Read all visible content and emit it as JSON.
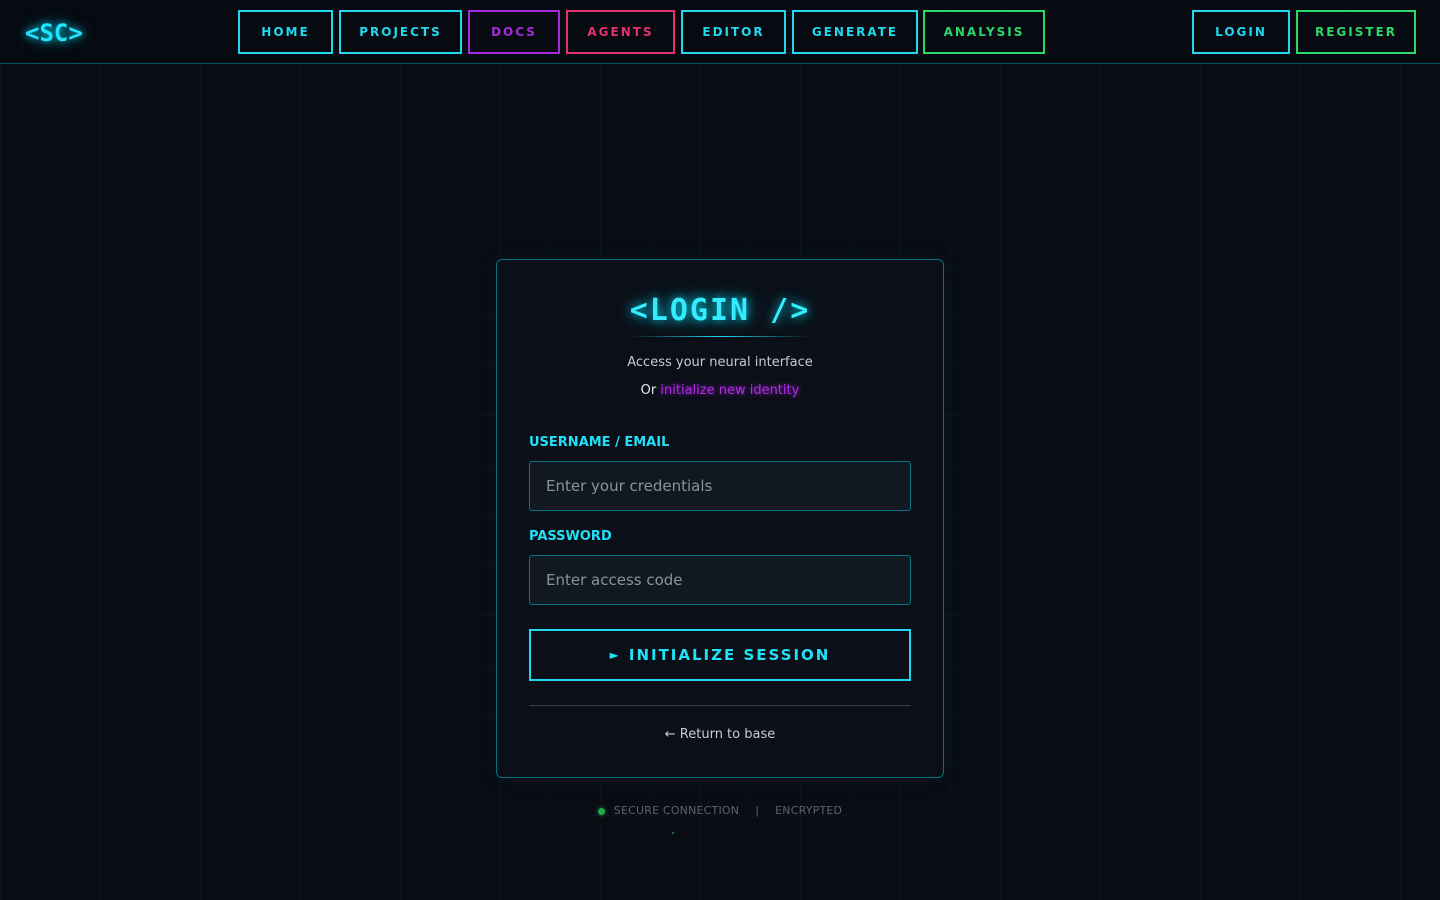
{
  "brand": {
    "logo_text": "<SC>"
  },
  "nav": {
    "items": [
      {
        "label": "HOME",
        "color": "#22d8f0"
      },
      {
        "label": "PROJECTS",
        "color": "#22d8f0"
      },
      {
        "label": "DOCS",
        "color": "#a42bdb"
      },
      {
        "label": "AGENTS",
        "color": "#e3306f"
      },
      {
        "label": "EDITOR",
        "color": "#22d8f0"
      },
      {
        "label": "GENERATE",
        "color": "#22d8f0"
      },
      {
        "label": "ANALYSIS",
        "color": "#2bd66b"
      }
    ],
    "auth": {
      "login_label": "LOGIN",
      "register_label": "REGISTER"
    }
  },
  "login_card": {
    "title": "<LOGIN />",
    "subtitle": "Access your neural interface",
    "alt_prefix": "Or",
    "alt_link": "initialize new identity",
    "username": {
      "label": "USERNAME / EMAIL",
      "placeholder": "Enter your credentials",
      "value": ""
    },
    "password": {
      "label": "PASSWORD",
      "placeholder": "Enter access code",
      "value": ""
    },
    "submit": {
      "icon": "play-icon",
      "icon_glyph": "►",
      "label": "INITIALIZE SESSION"
    },
    "return_link": "← Return to base"
  },
  "status": {
    "connection": "SECURE CONNECTION",
    "separator": "|",
    "encryption": "ENCRYPTED",
    "indicator_color": "#1faa4c"
  },
  "theme": {
    "background": "#090c12",
    "accent_cyan": "#22d8f0",
    "accent_purple": "#a42bdb",
    "accent_pink": "#e3306f",
    "accent_green": "#2bd66b"
  }
}
